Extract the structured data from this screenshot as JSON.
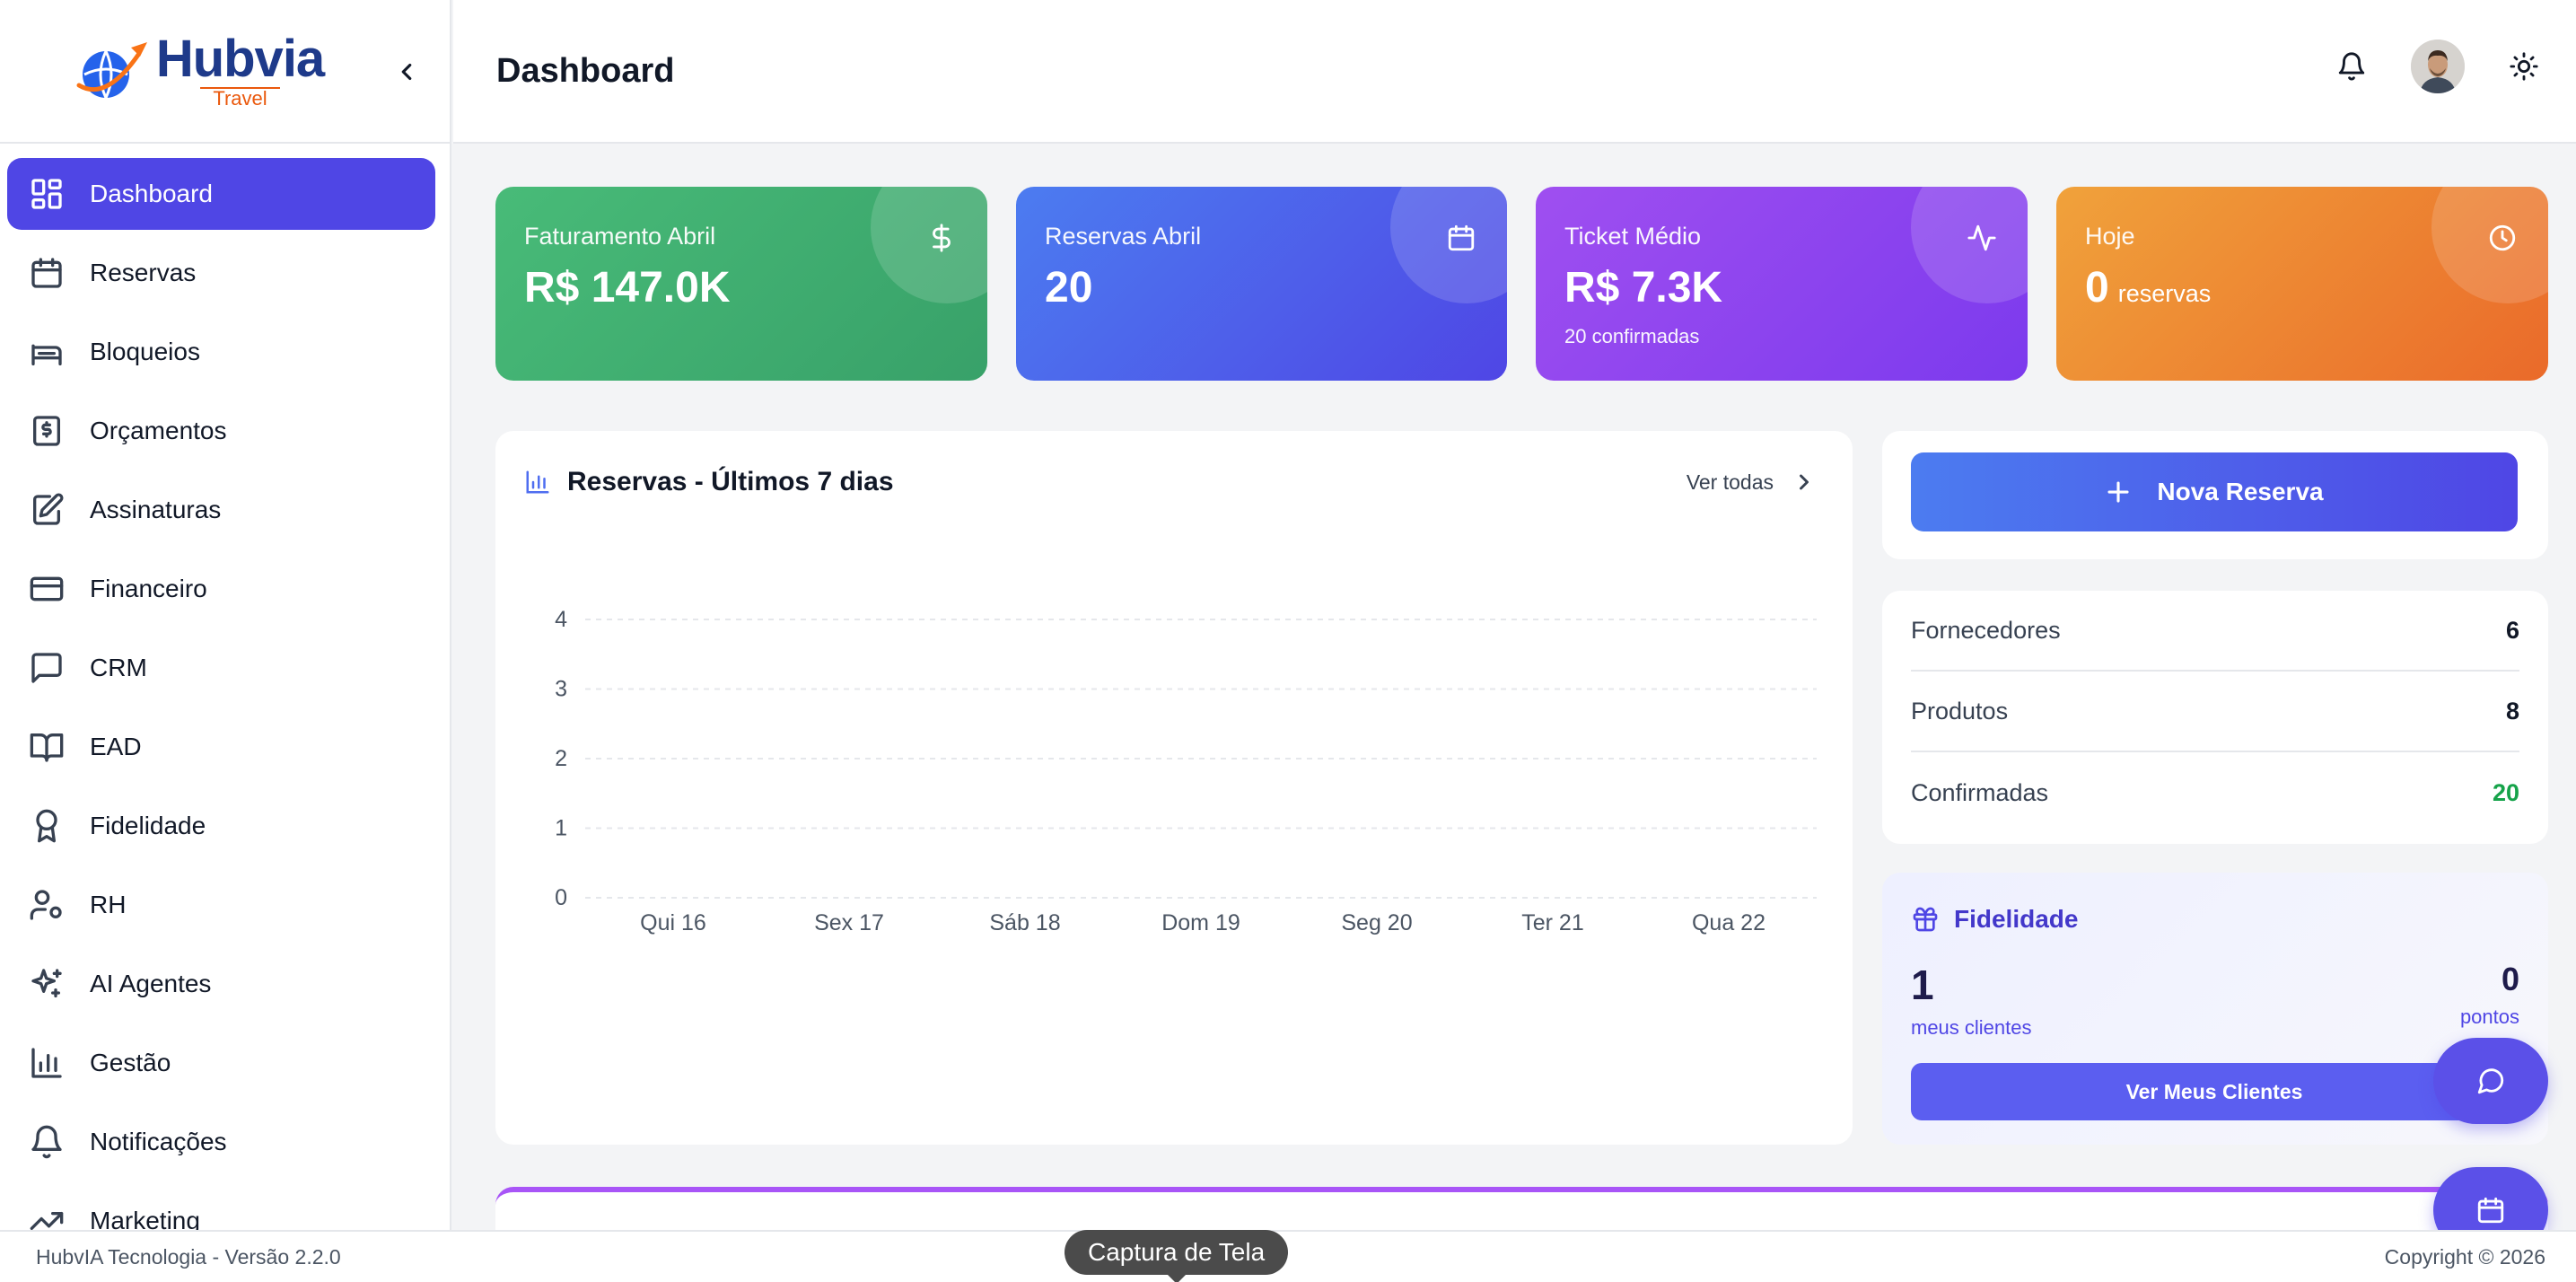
{
  "brand": {
    "name": "Hubvia",
    "tagline": "Travel"
  },
  "header": {
    "title": "Dashboard"
  },
  "sidebar": {
    "items": [
      {
        "label": "Dashboard",
        "icon": "dashboard-icon",
        "active": true
      },
      {
        "label": "Reservas",
        "icon": "calendar-icon"
      },
      {
        "label": "Bloqueios",
        "icon": "bed-icon"
      },
      {
        "label": "Orçamentos",
        "icon": "dollar-document-icon"
      },
      {
        "label": "Assinaturas",
        "icon": "signature-icon"
      },
      {
        "label": "Financeiro",
        "icon": "credit-card-icon"
      },
      {
        "label": "CRM",
        "icon": "chat-icon"
      },
      {
        "label": "EAD",
        "icon": "book-icon"
      },
      {
        "label": "Fidelidade",
        "icon": "award-icon"
      },
      {
        "label": "RH",
        "icon": "user-gear-icon"
      },
      {
        "label": "AI Agentes",
        "icon": "sparkles-icon"
      },
      {
        "label": "Gestão",
        "icon": "bar-chart-icon"
      },
      {
        "label": "Notificações",
        "icon": "bell-icon"
      },
      {
        "label": "Marketing",
        "icon": "trending-up-icon"
      }
    ]
  },
  "stats": [
    {
      "label": "Faturamento Abril",
      "value": "R$ 147.0K",
      "icon": "dollar-icon",
      "color": "#48bb78"
    },
    {
      "label": "Reservas Abril",
      "value": "20",
      "icon": "calendar-icon",
      "color": "#4f6ef0"
    },
    {
      "label": "Ticket Médio",
      "value": "R$ 7.3K",
      "sub": "20 confirmadas",
      "icon": "activity-icon",
      "color": "#8b46ee"
    },
    {
      "label": "Hoje",
      "value": "0",
      "unit": "reservas",
      "icon": "clock-icon",
      "color": "#ee8a33"
    }
  ],
  "chart": {
    "title": "Reservas - Últimos 7 dias",
    "see_all": "Ver todas"
  },
  "chart_data": {
    "type": "bar",
    "title": "Reservas - Últimos 7 dias",
    "categories": [
      "Qui 16",
      "Sex 17",
      "Sáb 18",
      "Dom 19",
      "Seg 20",
      "Ter 21",
      "Qua 22"
    ],
    "values": [
      0,
      0,
      0,
      0,
      0,
      0,
      0
    ],
    "yticks": [
      "0",
      "1",
      "2",
      "3",
      "4"
    ],
    "ylim": [
      0,
      4
    ],
    "grid": true
  },
  "actions": {
    "new_reservation": "Nova Reserva"
  },
  "summary": [
    {
      "label": "Fornecedores",
      "value": "6"
    },
    {
      "label": "Produtos",
      "value": "8"
    },
    {
      "label": "Confirmadas",
      "value": "20",
      "color": "#16a34a"
    }
  ],
  "loyalty": {
    "title": "Fidelidade",
    "clients": "1",
    "clients_label": "meus clientes",
    "points": "0",
    "points_label": "pontos",
    "button": "Ver Meus Clientes"
  },
  "footer": {
    "left": "HubvIA Tecnologia - Versão 2.2.0",
    "right": "Copyright © 2026"
  },
  "tooltip": "Captura de Tela"
}
